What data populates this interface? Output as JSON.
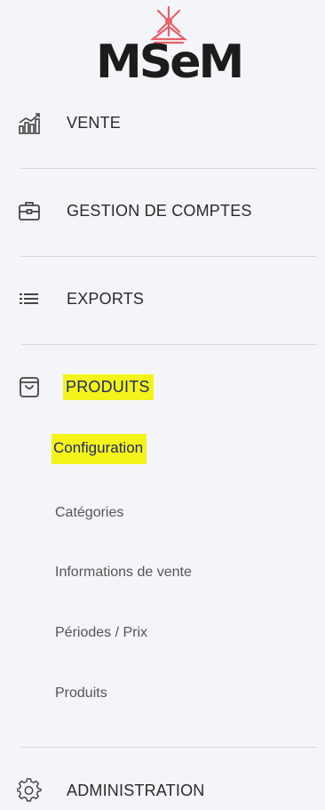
{
  "logo": {
    "text": "MSeM"
  },
  "nav": {
    "vente": {
      "label": "VENTE",
      "icon": "bar-chart-icon"
    },
    "gestion": {
      "label": "GESTION DE COMPTES",
      "icon": "briefcase-icon"
    },
    "exports": {
      "label": "EXPORTS",
      "icon": "list-icon"
    },
    "produits": {
      "label": "PRODUITS",
      "icon": "shopping-bag-icon",
      "expanded": true,
      "children": [
        {
          "label": "Configuration",
          "active": true
        },
        {
          "label": "Catégories"
        },
        {
          "label": "Informations de vente"
        },
        {
          "label": "Périodes / Prix"
        },
        {
          "label": "Produits"
        }
      ]
    },
    "administration": {
      "label": "ADMINISTRATION",
      "icon": "gear-icon"
    }
  },
  "colors": {
    "highlight": "#f4f31a",
    "background": "#f4f5f9",
    "active_text": "#1f2a6a",
    "logo_accent": "#e8606a"
  }
}
